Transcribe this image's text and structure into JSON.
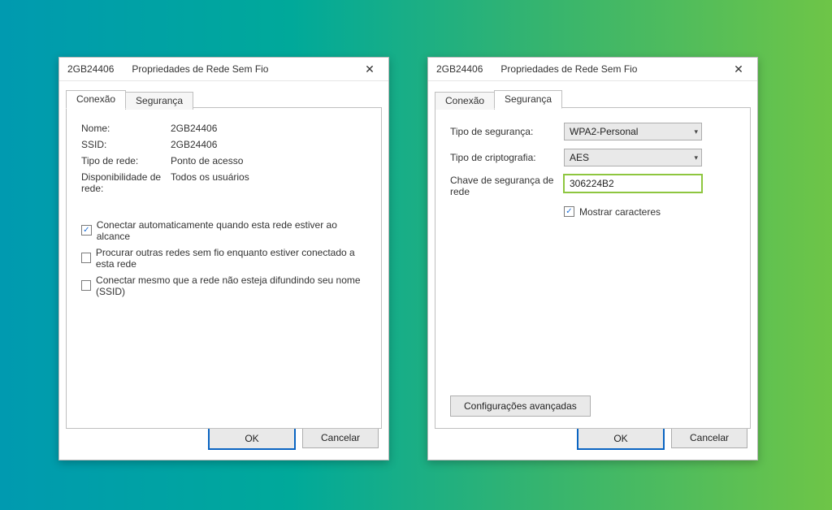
{
  "arrowColor": "#9aca3c",
  "leftDialog": {
    "networkName": "2GB24406",
    "title": "Propriedades de Rede Sem Fio",
    "tabs": {
      "connection": "Conexão",
      "security": "Segurança"
    },
    "fields": {
      "name": {
        "label": "Nome:",
        "value": "2GB24406"
      },
      "ssid": {
        "label": "SSID:",
        "value": "2GB24406"
      },
      "netType": {
        "label": "Tipo de rede:",
        "value": "Ponto de acesso"
      },
      "avail": {
        "label": "Disponibilidade de rede:",
        "value": "Todos os usuários"
      }
    },
    "checks": {
      "autoConnect": {
        "checked": true,
        "label": "Conectar automaticamente quando esta rede estiver ao alcance"
      },
      "lookOther": {
        "checked": false,
        "label": "Procurar outras redes sem fio enquanto estiver conectado a esta rede"
      },
      "connectHidden": {
        "checked": false,
        "label": "Conectar mesmo que a rede não esteja difundindo seu nome (SSID)"
      }
    },
    "buttons": {
      "ok": "OK",
      "cancel": "Cancelar"
    }
  },
  "rightDialog": {
    "networkName": "2GB24406",
    "title": "Propriedades de Rede Sem Fio",
    "tabs": {
      "connection": "Conexão",
      "security": "Segurança"
    },
    "fields": {
      "secType": {
        "label": "Tipo de segurança:",
        "value": "WPA2-Personal"
      },
      "cryptType": {
        "label": "Tipo de criptografia:",
        "value": "AES"
      },
      "key": {
        "label": "Chave de segurança de rede",
        "value": "306224B2"
      }
    },
    "showChars": {
      "checked": true,
      "label": "Mostrar caracteres"
    },
    "advancedButton": "Configurações avançadas",
    "buttons": {
      "ok": "OK",
      "cancel": "Cancelar"
    }
  }
}
